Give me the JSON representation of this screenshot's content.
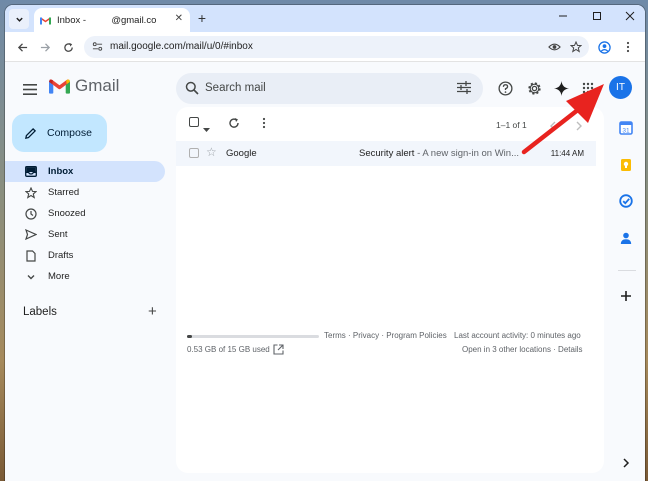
{
  "browser": {
    "tab_title_prefix": "Inbox -",
    "tab_title_suffix": "@gmail.com - G",
    "tab_close": "✕",
    "new_tab": "+",
    "url": "mail.google.com/mail/u/0/#inbox"
  },
  "gmail": {
    "logo_text": "Gmail",
    "search_placeholder": "Search mail",
    "avatar_initials": "IT",
    "compose_label": "Compose",
    "nav": [
      {
        "label": "Inbox",
        "icon": "inbox-icon",
        "active": true
      },
      {
        "label": "Starred",
        "icon": "star-icon"
      },
      {
        "label": "Snoozed",
        "icon": "clock-icon"
      },
      {
        "label": "Sent",
        "icon": "send-icon"
      },
      {
        "label": "Drafts",
        "icon": "draft-icon"
      },
      {
        "label": "More",
        "icon": "chevron-down-icon"
      }
    ],
    "labels_header": "Labels",
    "labels_add": "+",
    "pagination": "1–1 of 1",
    "messages": [
      {
        "sender": "Google",
        "subject": "Security alert",
        "snippet": " - A new sign-in on Win...",
        "time": "11:44 AM"
      }
    ],
    "storage_used_fraction": 0.035,
    "storage_text": "0.53 GB of 15 GB used",
    "footer_links": "Terms · Privacy · Program Policies",
    "last_activity": "Last account activity: 0 minutes ago",
    "other_locations": "Open in 3 other locations · Details"
  },
  "colors": {
    "accent_blue": "#1a73e8",
    "compose_bg": "#c2e7ff",
    "active_nav_bg": "#d3e3fd",
    "annotation_arrow": "#e8231f"
  }
}
